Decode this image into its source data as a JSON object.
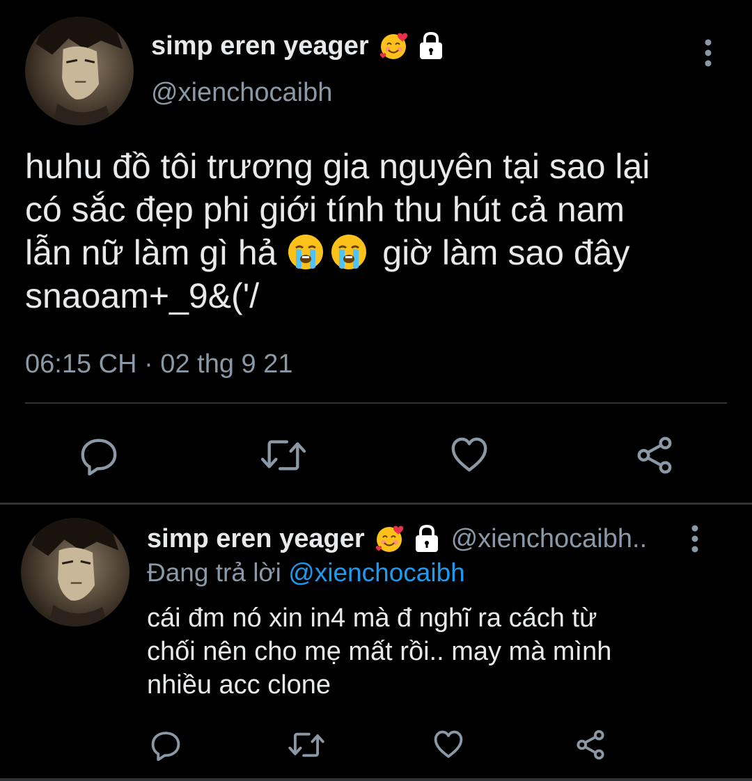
{
  "main_tweet": {
    "display_name": "simp eren yeager",
    "name_emoji": "smiling-face-with-hearts",
    "protected_icon": "lock-icon",
    "handle": "@xienchocaibh",
    "text_lines": [
      "huhu đồ tôi trương gia nguyên tại sao lại",
      "có sắc đẹp phi giới tính thu hút cả nam",
      "lẫn nữ làm gì hả",
      "giờ làm sao đây",
      "snaoam+_9&('/"
    ],
    "inline_emoji": "loudly-crying-face",
    "timestamp": "06:15 CH · 02 thg 9 21",
    "actions": [
      "reply-icon",
      "retweet-icon",
      "like-icon",
      "share-icon"
    ]
  },
  "reply_tweet": {
    "display_name": "simp eren yeager",
    "name_emoji": "smiling-face-with-hearts",
    "protected_icon": "lock-icon",
    "handle": "@xienchocaibh..",
    "replying_to_label": "Đang trả lời",
    "replying_to_handle": "@xienchocaibh",
    "text_lines": [
      "cái đm nó xin in4 mà đ nghĩ ra cách từ",
      "chối nên cho mẹ mất rồi.. may mà mình",
      "nhiều acc clone"
    ],
    "actions": [
      "reply-icon",
      "retweet-icon",
      "like-icon",
      "share-icon"
    ]
  },
  "colors": {
    "background": "#000000",
    "text_primary": "#e7e9ea",
    "text_secondary": "#8b98a5",
    "accent": "#1d9bf0",
    "divider": "#2f3336"
  }
}
